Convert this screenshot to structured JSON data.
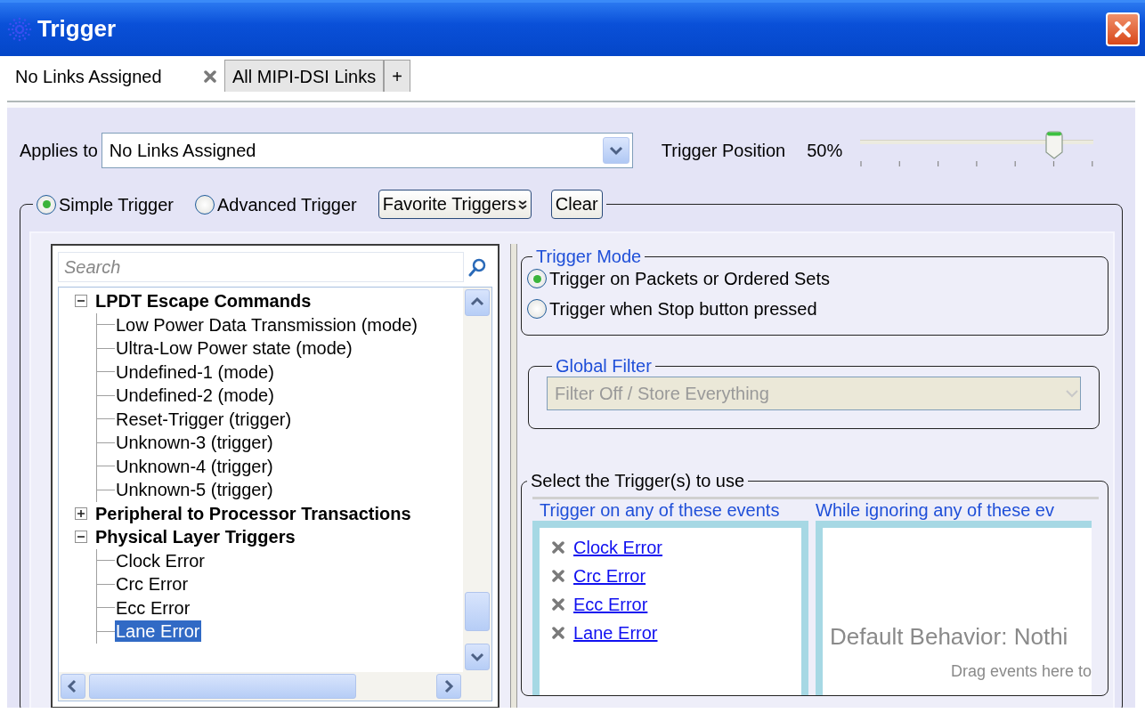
{
  "window": {
    "title": "Trigger"
  },
  "tabs": [
    {
      "label": "No Links Assigned",
      "selected": true,
      "closable": true
    },
    {
      "label": "All MIPI-DSI Links",
      "selected": false,
      "closable": false
    },
    {
      "label": "+",
      "selected": false,
      "closable": false
    }
  ],
  "applies_to": {
    "label": "Applies to",
    "value": "No Links Assigned"
  },
  "trigger_position": {
    "label": "Trigger Position",
    "reading": "50%",
    "level": 0.83
  },
  "trigger_type": [
    {
      "label": "Simple Trigger",
      "selected": true
    },
    {
      "label": "Advanced Trigger",
      "selected": false
    }
  ],
  "buttons": [
    {
      "label": "Favorite Triggers",
      "kind": "menu"
    },
    {
      "label": "Clear",
      "kind": "plain"
    }
  ],
  "search": {
    "placeholder": "Search"
  },
  "tree": [
    {
      "label": "LPDT Escape Commands",
      "expanded": true,
      "children": [
        {
          "label": "Low Power Data Transmission (mode)",
          "selected": false
        },
        {
          "label": "Ultra-Low Power state (mode)",
          "selected": false
        },
        {
          "label": "Undefined-1 (mode)",
          "selected": false
        },
        {
          "label": "Undefined-2 (mode)",
          "selected": false
        },
        {
          "label": "Reset-Trigger (trigger)",
          "selected": false
        },
        {
          "label": "Unknown-3 (trigger)",
          "selected": false
        },
        {
          "label": "Unknown-4 (trigger)",
          "selected": false
        },
        {
          "label": "Unknown-5 (trigger)",
          "selected": false
        }
      ]
    },
    {
      "label": "Peripheral to Processor Transactions",
      "expanded": false
    },
    {
      "label": "Physical Layer Triggers",
      "expanded": true,
      "children": [
        {
          "label": "Clock Error",
          "selected": false
        },
        {
          "label": "Crc Error",
          "selected": false
        },
        {
          "label": "Ecc Error",
          "selected": false
        },
        {
          "label": "Lane Error",
          "selected": true
        }
      ]
    }
  ],
  "trigger_mode": {
    "title": "Trigger Mode",
    "options": [
      {
        "label": "Trigger on Packets or Ordered Sets",
        "selected": true
      },
      {
        "label": "Trigger when Stop button pressed",
        "selected": false
      }
    ]
  },
  "global_filter": {
    "title": "Global Filter",
    "value": "Filter Off / Store Everything",
    "disabled": true
  },
  "select_triggers": {
    "title": "Select the Trigger(s) to use",
    "trigger_on": {
      "header": "Trigger on any of these events",
      "events": [
        "Clock Error",
        "Crc Error",
        "Ecc Error",
        "Lane Error"
      ]
    },
    "ignoring": {
      "header": "While ignoring any of these ev",
      "message": "Default Behavior: Nothi",
      "hint": "Drag events here to"
    }
  }
}
